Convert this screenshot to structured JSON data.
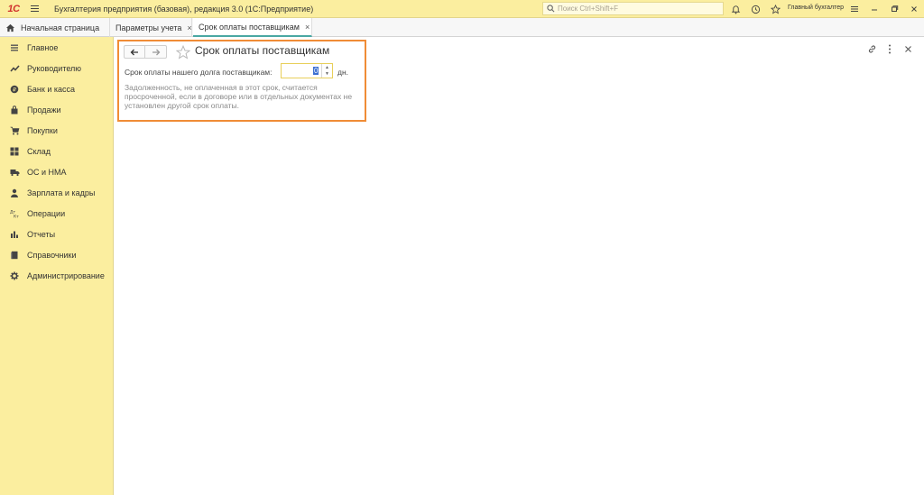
{
  "app": {
    "logo_text": "1С",
    "title": "Бухгалтерия предприятия (базовая), редакция 3.0  (1С:Предприятие)",
    "search_placeholder": "Поиск Ctrl+Shift+F",
    "user": "Главный бухгалтер"
  },
  "tabs": [
    {
      "label": "Начальная страница",
      "closable": false,
      "active": false
    },
    {
      "label": "Параметры учета",
      "closable": true,
      "active": false
    },
    {
      "label": "Срок оплаты поставщикам",
      "closable": true,
      "active": true
    }
  ],
  "tab_close_glyph": "×",
  "sidebar": {
    "items": [
      {
        "label": "Главное",
        "icon": "list-icon"
      },
      {
        "label": "Руководителю",
        "icon": "trend-icon"
      },
      {
        "label": "Банк и касса",
        "icon": "coin-icon"
      },
      {
        "label": "Продажи",
        "icon": "bag-icon"
      },
      {
        "label": "Покупки",
        "icon": "cart-icon"
      },
      {
        "label": "Склад",
        "icon": "grid-icon"
      },
      {
        "label": "ОС и НМА",
        "icon": "truck-icon"
      },
      {
        "label": "Зарплата и кадры",
        "icon": "person-icon"
      },
      {
        "label": "Операции",
        "icon": "dt-kt-icon"
      },
      {
        "label": "Отчеты",
        "icon": "bar-chart-icon"
      },
      {
        "label": "Справочники",
        "icon": "book-icon"
      },
      {
        "label": "Администрирование",
        "icon": "gear-icon"
      }
    ]
  },
  "form": {
    "title": "Срок оплаты поставщикам",
    "field_label": "Срок оплаты нашего долга поставщикам:",
    "field_value": "0",
    "unit": "дн.",
    "hint": "Задолженность, не оплаченная в этот срок, считается просроченной, если в договоре или в отдельных документах не установлен другой срок оплаты."
  },
  "colors": {
    "accent_bar": "#fbee9f",
    "highlight_frame": "#f08c36",
    "active_tab_underline": "#4aa8a3"
  }
}
